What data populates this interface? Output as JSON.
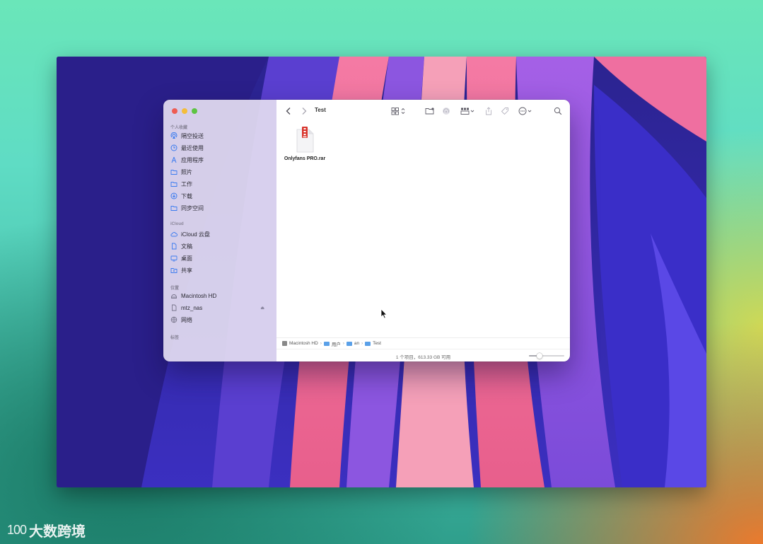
{
  "window": {
    "title": "Test"
  },
  "sidebar": {
    "sections": [
      {
        "label": "个人收藏"
      },
      {
        "label": "iCloud"
      },
      {
        "label": "位置"
      },
      {
        "label": "标签"
      }
    ],
    "favorites": [
      {
        "label": "隔空投送",
        "icon": "airdrop-icon"
      },
      {
        "label": "最近使用",
        "icon": "clock-icon"
      },
      {
        "label": "应用程序",
        "icon": "applications-icon"
      },
      {
        "label": "照片",
        "icon": "folder-icon"
      },
      {
        "label": "工作",
        "icon": "folder-icon"
      },
      {
        "label": "下载",
        "icon": "download-icon"
      },
      {
        "label": "同步空间",
        "icon": "folder-icon"
      }
    ],
    "icloud": [
      {
        "label": "iCloud 云盘",
        "icon": "cloud-icon"
      },
      {
        "label": "文稿",
        "icon": "document-icon"
      },
      {
        "label": "桌面",
        "icon": "desktop-icon"
      },
      {
        "label": "共享",
        "icon": "shared-folder-icon"
      }
    ],
    "locations": [
      {
        "label": "Macintosh HD",
        "icon": "disk-icon"
      },
      {
        "label": "mtz_nas",
        "icon": "document-icon",
        "eject": "⏏"
      },
      {
        "label": "网络",
        "icon": "network-icon"
      }
    ]
  },
  "files": [
    {
      "name": "Onlyfans PRO.rar",
      "icon": "rar-archive-icon"
    }
  ],
  "pathbar": {
    "items": [
      "Macintosh HD",
      "用户",
      "an",
      "Test"
    ]
  },
  "statusbar": {
    "text": "1 个项目，613.33 GB 可用",
    "zoom": 0.3
  },
  "watermark": {
    "logo": "100",
    "text": "大数跨境"
  },
  "colors": {
    "accent": "#3a7bef",
    "close": "#ee5c53",
    "minimize": "#f4bd3a",
    "maximize": "#5dc442",
    "archive_red": "#d8332b"
  }
}
